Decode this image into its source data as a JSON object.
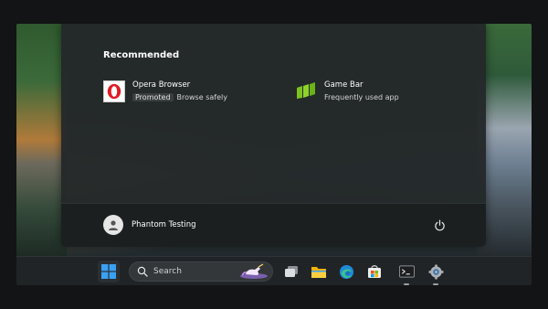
{
  "start_menu": {
    "recommended_title": "Recommended",
    "items": [
      {
        "name": "Opera Browser",
        "badge": "Promoted",
        "subtitle": "Browse safely",
        "icon": "opera-icon"
      },
      {
        "name": "Game Bar",
        "subtitle": "Frequently used app",
        "icon": "game-bar-icon"
      }
    ],
    "user_name": "Phantom Testing",
    "power_icon": "power-icon"
  },
  "taskbar": {
    "search_label": "Search",
    "apps": [
      {
        "icon": "windows-start-icon"
      },
      {
        "icon": "task-view-icon"
      },
      {
        "icon": "file-explorer-icon"
      },
      {
        "icon": "edge-icon"
      },
      {
        "icon": "microsoft-store-icon"
      },
      {
        "icon": "terminal-icon"
      },
      {
        "icon": "settings-icon"
      }
    ]
  },
  "colors": {
    "accent": "#0078d4",
    "opera_red": "#e01b24",
    "game_bar_green": "#7cc31f"
  }
}
